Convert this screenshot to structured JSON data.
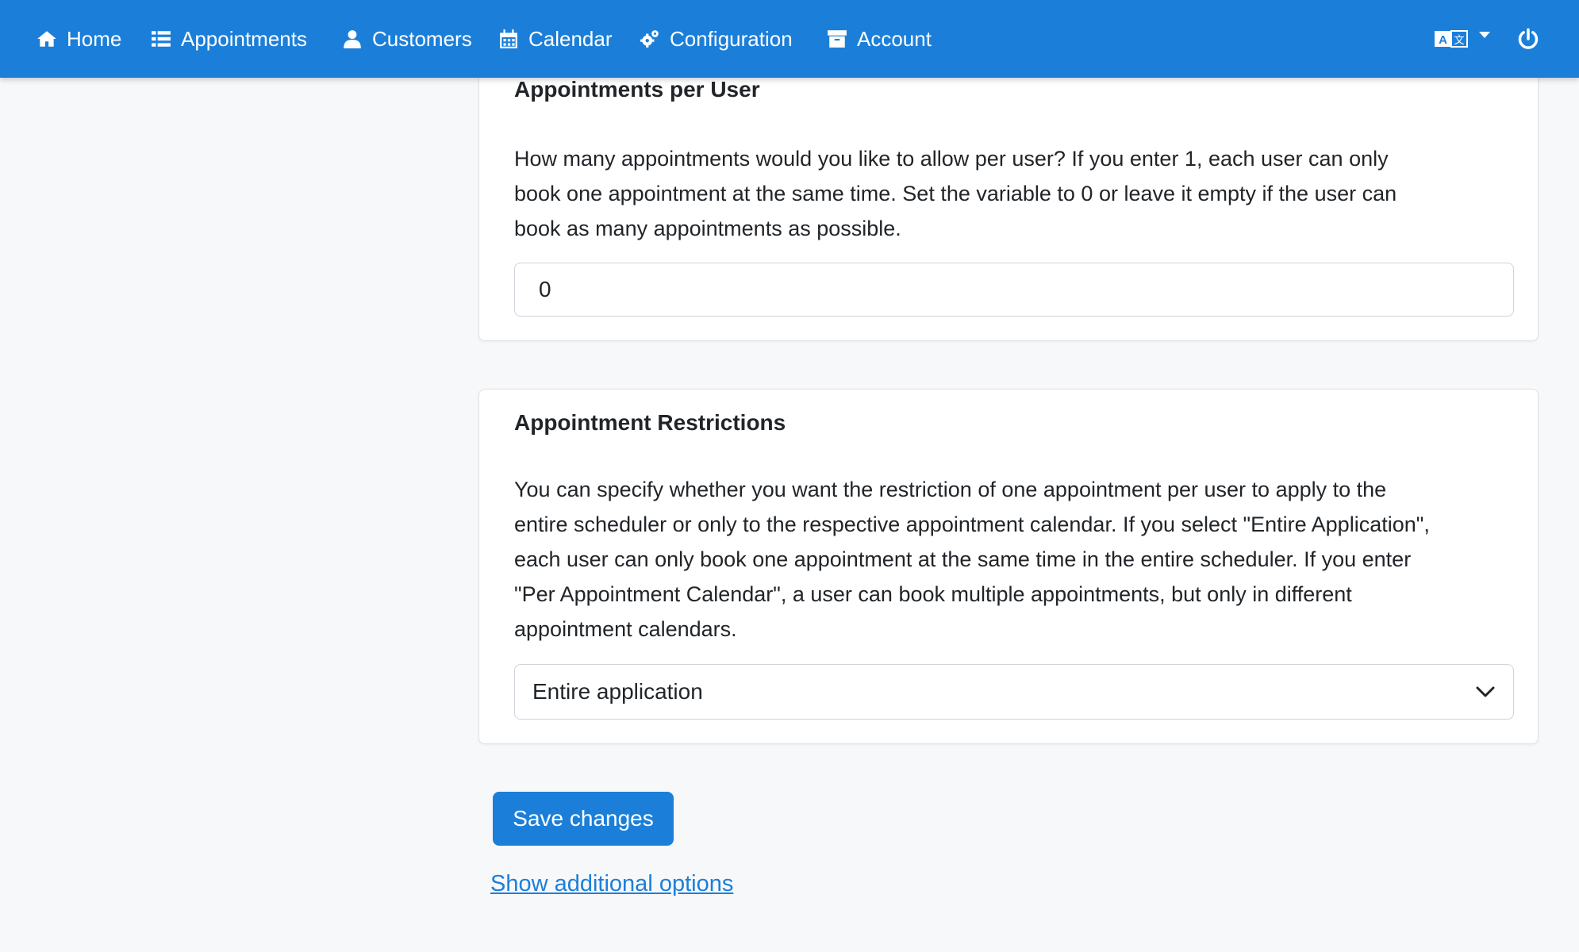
{
  "nav": {
    "items": [
      {
        "label": "Home",
        "icon": "home-icon"
      },
      {
        "label": "Appointments",
        "icon": "list-icon"
      },
      {
        "label": "Customers",
        "icon": "user-icon"
      },
      {
        "label": "Calendar",
        "icon": "calendar-icon"
      },
      {
        "label": "Configuration",
        "icon": "gears-icon"
      },
      {
        "label": "Account",
        "icon": "archive-icon"
      }
    ],
    "right": {
      "language_icon": "language-icon",
      "dropdown_icon": "caret-down-icon",
      "logout_icon": "power-icon"
    },
    "accent_color": "#1b7fd9"
  },
  "appointments_per_user": {
    "title": "Appointments per User",
    "line1": "How many appointments would you like to allow per user? If you enter 1, each user can only",
    "line2": "book one appointment at the same time. Set the variable to 0 or leave it empty if the user can",
    "line3": "book as many appointments as possible.",
    "value": "0"
  },
  "appointment_restrictions": {
    "title": "Appointment Restrictions",
    "line1": "You can specify whether you want the restriction of one appointment per user to apply to the",
    "line2": "entire scheduler or only to the respective appointment calendar. If you select \"Entire Application\",",
    "line3": "each user can only book one appointment at the same time in the entire scheduler. If you enter",
    "line4": "\"Per Appointment Calendar\", a user can book multiple appointments, but only in different",
    "line5": "appointment calendars.",
    "selected": "Entire application"
  },
  "actions": {
    "save_label": "Save changes",
    "more_label": "Show additional options"
  }
}
